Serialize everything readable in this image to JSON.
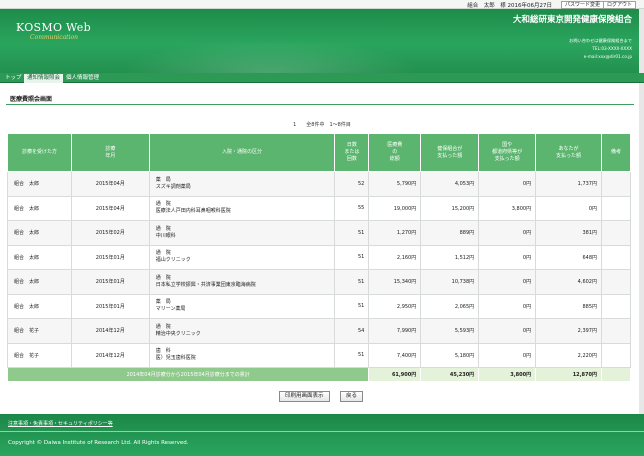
{
  "topbar": {
    "user": "組合　太郎　様 2016年06月27日",
    "password_button": "パスワード変更",
    "logout_button": "ログアウト"
  },
  "header": {
    "logo": "KOSMO Web",
    "logo_sub": "Communication",
    "org_name": "大和総研東京開発健康保険組合",
    "contact_lines": [
      "お問い合わせは健康保険組合まで",
      "TEL:03-XXXX-XXXX",
      "e-mail:xxx@dir01.co.jp"
    ]
  },
  "nav": {
    "items": [
      "トップ",
      "通知情報照会",
      "個人情報管理"
    ],
    "active_index": 1
  },
  "page": {
    "title": "医療費照会画面",
    "pager": "1　　全8件中　1～8件目"
  },
  "table": {
    "headers": [
      "診療を受けた方",
      "診療\n年月",
      "入院・通院の区分",
      "日数\nまたは\n回数",
      "医療費\nの\n総額",
      "健保組合が\n支払った額",
      "国や\n都道府県等が\n支払った額",
      "あなたが\n支払った額",
      "備考"
    ],
    "rows": [
      {
        "name": "組合　太郎",
        "ym": "2015年04月",
        "kind": "薬　局",
        "facility": "スズキ調剤薬局",
        "days": "52",
        "total": "5,790円",
        "kenpo": "4,053円",
        "gov": "0円",
        "self": "1,737円",
        "note": ""
      },
      {
        "name": "組合　太郎",
        "ym": "2015年04月",
        "kind": "通　院",
        "facility": "医療法人戸田内科耳鼻咽喉科医院",
        "days": "55",
        "total": "19,000円",
        "kenpo": "15,200円",
        "gov": "3,800円",
        "self": "0円",
        "note": ""
      },
      {
        "name": "組合　太郎",
        "ym": "2015年02月",
        "kind": "通　院",
        "facility": "中川眼科",
        "days": "51",
        "total": "1,270円",
        "kenpo": "889円",
        "gov": "0円",
        "self": "381円",
        "note": ""
      },
      {
        "name": "組合　太郎",
        "ym": "2015年01月",
        "kind": "通　院",
        "facility": "福山クリニック",
        "days": "51",
        "total": "2,160円",
        "kenpo": "1,512円",
        "gov": "0円",
        "self": "648円",
        "note": ""
      },
      {
        "name": "組合　太郎",
        "ym": "2015年01月",
        "kind": "通　院",
        "facility": "日本私立学校振興・共済事業団東京臨海病院",
        "days": "51",
        "total": "15,340円",
        "kenpo": "10,738円",
        "gov": "0円",
        "self": "4,602円",
        "note": ""
      },
      {
        "name": "組合　太郎",
        "ym": "2015年01月",
        "kind": "薬　局",
        "facility": "マリーン薬局",
        "days": "51",
        "total": "2,950円",
        "kenpo": "2,065円",
        "gov": "0円",
        "self": "885円",
        "note": ""
      },
      {
        "name": "組合　花子",
        "ym": "2014年12月",
        "kind": "通　院",
        "facility": "精治中央クリニック",
        "days": "54",
        "total": "7,990円",
        "kenpo": "5,593円",
        "gov": "0円",
        "self": "2,397円",
        "note": ""
      },
      {
        "name": "組合　花子",
        "ym": "2014年12月",
        "kind": "歯　科",
        "facility": "医）児玉歯科医院",
        "days": "51",
        "total": "7,400円",
        "kenpo": "5,180円",
        "gov": "0円",
        "self": "2,220円",
        "note": ""
      }
    ],
    "summary_label": "2014年04月診療分から2015年04月診療分までの累計",
    "summary": {
      "total": "61,900円",
      "kenpo": "45,230円",
      "gov": "3,800円",
      "self": "12,870円"
    }
  },
  "buttons": {
    "print": "印刷用画面表示",
    "back": "戻る"
  },
  "footer": {
    "links": "注意事項・免責事項・セキュリティポリシー等",
    "copyright": "Copyright © Daiwa Institute of Research Ltd. All Rights Reserved."
  },
  "colors": {
    "brand_green": "#2aa55e",
    "header_cell": "#5cb56f",
    "summary": "#8fc98c"
  }
}
